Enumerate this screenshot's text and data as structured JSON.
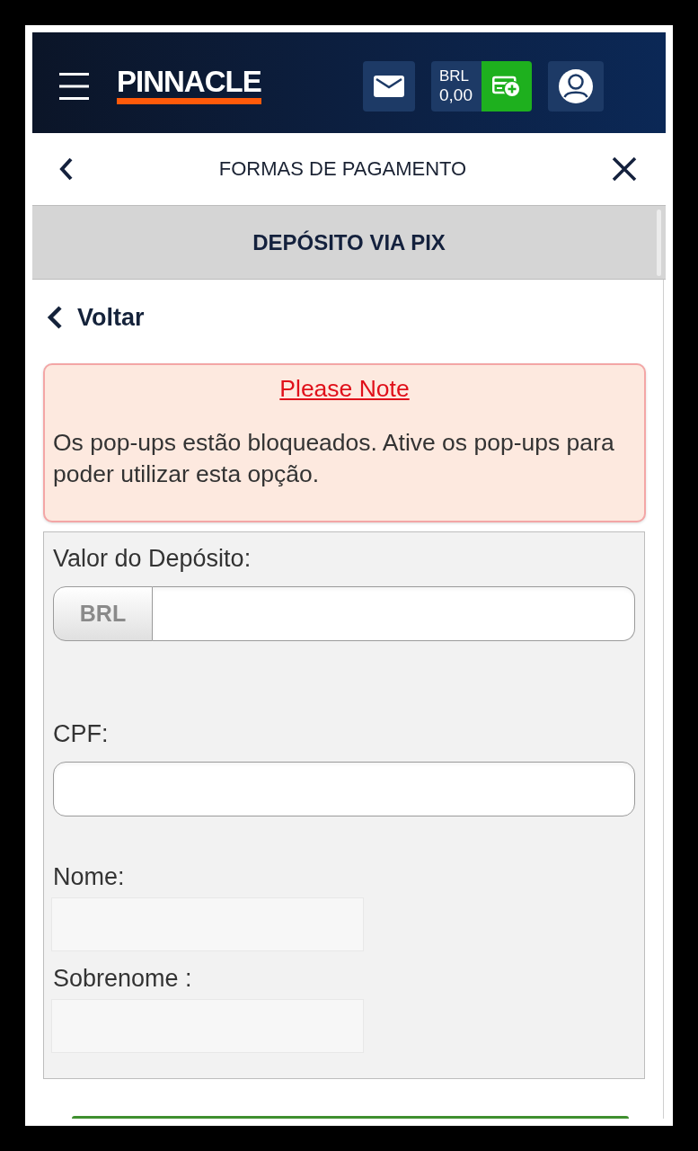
{
  "header": {
    "logo": "PINNACLE",
    "balance": {
      "currency": "BRL",
      "amount": "0,00"
    }
  },
  "nav": {
    "title": "FORMAS DE PAGAMENTO"
  },
  "banner": {
    "title": "DEPÓSITO VIA PIX"
  },
  "back_link": {
    "label": "Voltar"
  },
  "notice": {
    "title": "Please Note",
    "message": "Os pop-ups estão bloqueados. Ative os pop-ups para poder utilizar esta opção."
  },
  "form": {
    "fields": [
      {
        "kind": "currency",
        "label": "Valor do Depósito:",
        "addon": "BRL"
      },
      {
        "kind": "text",
        "label": "CPF:"
      },
      {
        "kind": "plain",
        "label": "Nome:"
      },
      {
        "kind": "plain",
        "label": "Sobrenome :"
      }
    ]
  }
}
